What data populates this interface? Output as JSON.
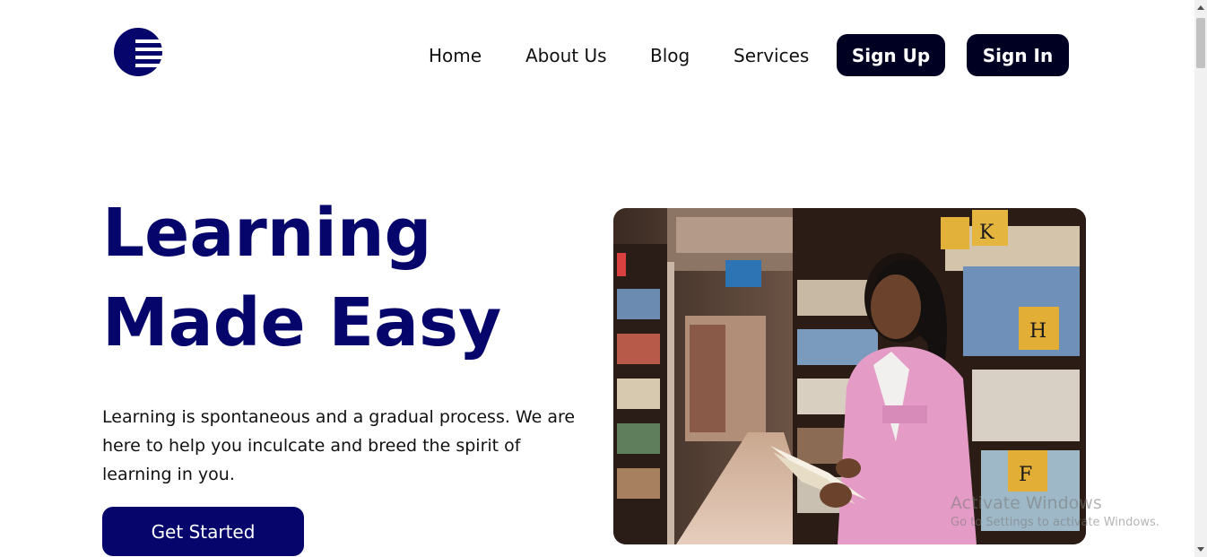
{
  "brand": {
    "logo_icon": "striped-circle-logo",
    "color": "#05056b"
  },
  "nav": {
    "items": [
      {
        "label": "Home"
      },
      {
        "label": "About Us"
      },
      {
        "label": "Blog"
      },
      {
        "label": "Services"
      }
    ],
    "signup_label": "Sign Up",
    "signin_label": "Sign In",
    "button_color": "#000022"
  },
  "hero": {
    "title_line1": "Learning",
    "title_line2": "Made Easy",
    "description": "Learning is spontaneous and a gradual process. We are here to help you inculcate and breed the spirit of learning in you.",
    "cta_label": "Get Started",
    "title_color": "#05056b"
  },
  "watermark": {
    "title": "Activate Windows",
    "subtitle": "Go to Settings to activate Windows."
  }
}
